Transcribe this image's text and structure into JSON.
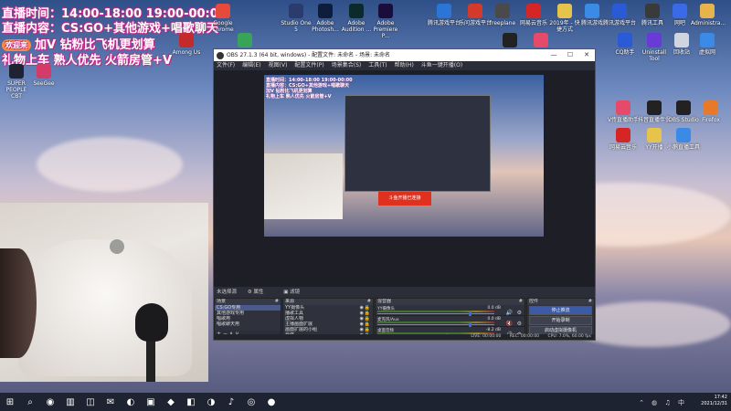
{
  "overlay": {
    "line1": "直播时间：14:00-18:00 19:00-00:00",
    "line2": "直播内容：CS:GO+其他游戏+唱歌聊天",
    "badge": "欢迎来",
    "line3": "加V 钻粉比飞机更划算",
    "line4": "礼物上车 熟人优先 火箭房管+V"
  },
  "desktop_icons_left": [
    {
      "label": "Google Chrome",
      "color": "#e64a3b"
    },
    {
      "label": "Among Us",
      "color": "#c42a2a"
    },
    {
      "label": "",
      "color": "#39a35a"
    },
    {
      "label": "SUPER PEOPLE CBT",
      "color": "#1e2233"
    },
    {
      "label": "SeeGee",
      "color": "#d23b6a"
    }
  ],
  "desktop_icons_top": [
    {
      "label": "Studio One 5",
      "color": "#2b3b6e"
    },
    {
      "label": "Adobe Photosh...",
      "color": "#0d1d3b"
    },
    {
      "label": "Adobe Audition ...",
      "color": "#0d2a2a"
    },
    {
      "label": "Adobe Premiere P...",
      "color": "#1a0d3b"
    },
    {
      "label": "腾讯游戏平台",
      "color": "#2a75d6"
    },
    {
      "label": "乐问游戏平台",
      "color": "#d33a2a"
    },
    {
      "label": "freeplane",
      "color": "#4a4a4a"
    },
    {
      "label": "网易云音乐",
      "color": "#d52525"
    },
    {
      "label": "2019年 - 快捷方式",
      "color": "#e6c34a"
    },
    {
      "label": "腾讯游戏",
      "color": "#3a8ae6"
    },
    {
      "label": "腾讯游戏平台",
      "color": "#2a5ad6"
    },
    {
      "label": "腾讯工具",
      "color": "#3a3a3a"
    },
    {
      "label": "网吧",
      "color": "#3a6ae6"
    },
    {
      "label": "Administra...",
      "color": "#e6b44a"
    }
  ],
  "desktop_icons_right": [
    {
      "label": "OBS Studio",
      "color": "#222"
    },
    {
      "label": "V传直播",
      "color": "#e64a6a"
    },
    {
      "label": "CQ助手",
      "color": "#2a5ad6"
    },
    {
      "label": "Uninstall Tool",
      "color": "#6a3ad6"
    },
    {
      "label": "回收站",
      "color": "#cfd6e0"
    },
    {
      "label": "虚拟网",
      "color": "#3a8ae6"
    },
    {
      "label": "V传直播助手",
      "color": "#e64a6a"
    },
    {
      "label": "抖音直播伴侣",
      "color": "#222"
    },
    {
      "label": "OBS Studio",
      "color": "#222"
    },
    {
      "label": "Firefox",
      "color": "#e67a2a"
    },
    {
      "label": "网易云音乐",
      "color": "#d52525"
    },
    {
      "label": "YY开播",
      "color": "#e6c34a"
    },
    {
      "label": "小鹅直播工具",
      "color": "#3a8ae6"
    }
  ],
  "obs": {
    "title": "OBS 27.1.3 (64 bit, windows) - 配置文件: 未命名 - 场景: 未命名",
    "menu": [
      "文件(F)",
      "编辑(E)",
      "视图(V)",
      "配置文件(P)",
      "场景集合(S)",
      "工具(T)",
      "帮助(H)",
      "斗鱼一键开播(O)"
    ],
    "preview_text": [
      "直播时间：14:00-18:00 19:00-00:00",
      "直播内容：CS:GO+其他游戏+唱歌聊天",
      "加V 钻粉比飞机更划算",
      "礼物上车 熟人优先 火箭房管+V"
    ],
    "inner_red": "斗鱼开播已连接",
    "context": {
      "selected": "未选择源",
      "properties": "属性",
      "filters": "滤镜"
    },
    "scenes": {
      "header": "场景",
      "items": [
        "CS:GO专用",
        "其他游戏专用",
        "唱歌用",
        "唱歌聊天用"
      ]
    },
    "sources": {
      "header": "来源",
      "items": [
        "YY摄像头",
        "播歌工具",
        "虚拟人物",
        "主播画面扩展",
        "画面扩展的小组",
        "自然",
        "3月截图",
        "歌曲",
        "1"
      ]
    },
    "mixer": {
      "header": "混音器",
      "channels": [
        {
          "name": "YY摄像头",
          "db": "0.0 dB",
          "level": 0.8,
          "muted": false
        },
        {
          "name": "麦克风/Aux",
          "db": "0.0 dB",
          "level": 0.8,
          "muted": true
        },
        {
          "name": "桌面音频",
          "db": "-8.2 dB",
          "level": 0.6,
          "muted": false
        }
      ]
    },
    "controls": {
      "header": "控件",
      "buttons": [
        "停止推流",
        "开始录制",
        "启动虚拟摄像机",
        "工作室模式",
        "设置",
        "退出"
      ]
    },
    "status": [
      "LIVE: 00:00:00",
      "REC: 00:00:00",
      "CPU: 7.0%, 60.00 fps"
    ]
  },
  "taskbar": {
    "time": "17:42",
    "date": "2021/12/31",
    "items": [
      "⊞",
      "⌕",
      "◉",
      "▥",
      "◫",
      "✉",
      "◐",
      "▣",
      "◆",
      "◧",
      "◑",
      "♪",
      "◎",
      "●"
    ]
  }
}
